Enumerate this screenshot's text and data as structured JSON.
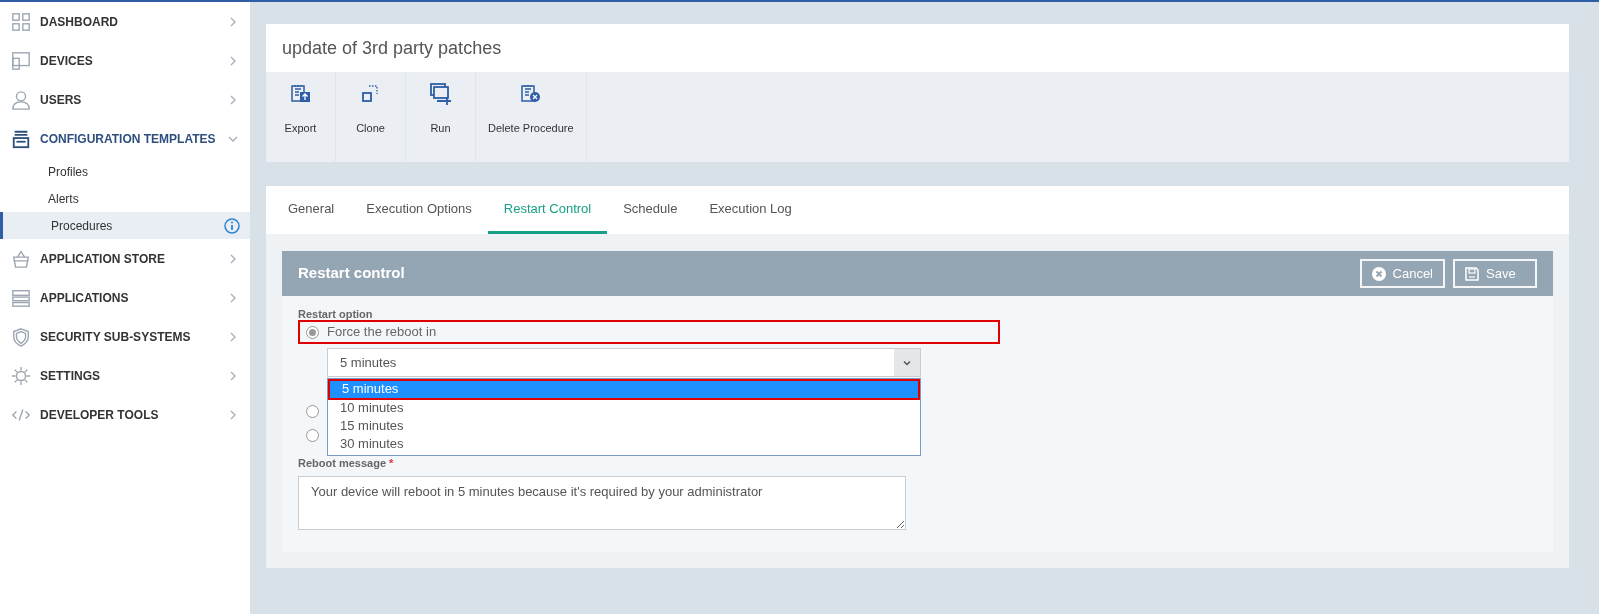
{
  "sidebar": {
    "items": [
      {
        "label": "DASHBOARD",
        "expanded": false
      },
      {
        "label": "DEVICES",
        "expanded": false
      },
      {
        "label": "USERS",
        "expanded": false
      },
      {
        "label": "CONFIGURATION TEMPLATES",
        "expanded": true,
        "children": [
          {
            "label": "Profiles",
            "selected": false
          },
          {
            "label": "Alerts",
            "selected": false
          },
          {
            "label": "Procedures",
            "selected": true
          }
        ]
      },
      {
        "label": "APPLICATION STORE",
        "expanded": false
      },
      {
        "label": "APPLICATIONS",
        "expanded": false
      },
      {
        "label": "SECURITY SUB-SYSTEMS",
        "expanded": false
      },
      {
        "label": "SETTINGS",
        "expanded": false
      },
      {
        "label": "DEVELOPER TOOLS",
        "expanded": false
      }
    ]
  },
  "page_title": "update of 3rd party patches",
  "toolbar": [
    "Export",
    "Clone",
    "Run",
    "Delete Procedure"
  ],
  "tabs": [
    {
      "label": "General",
      "selected": false
    },
    {
      "label": "Execution Options",
      "selected": false
    },
    {
      "label": "Restart Control",
      "selected": true
    },
    {
      "label": "Schedule",
      "selected": false
    },
    {
      "label": "Execution Log",
      "selected": false
    }
  ],
  "panel": {
    "title": "Restart control",
    "buttons": [
      "Cancel",
      "Save"
    ],
    "restart_option_label": "Restart option",
    "restart_options": [
      {
        "label": "Force the reboot in",
        "selected": true,
        "highlighted": true
      },
      {
        "selected": false,
        "highlighted": false
      },
      {
        "selected": false,
        "highlighted": false
      }
    ],
    "delay_select": {
      "value": "5 minutes",
      "options": [
        {
          "label": "5 minutes",
          "selected": true,
          "highlighted": true
        },
        {
          "label": "10 minutes",
          "selected": false,
          "highlighted": false
        },
        {
          "label": "15 minutes",
          "selected": false,
          "highlighted": false
        },
        {
          "label": "30 minutes",
          "selected": false,
          "highlighted": false
        }
      ]
    },
    "reboot_message_label": "Reboot message",
    "required_mark": "*",
    "reboot_message": "Your device will reboot in 5 minutes because it's required by your administrator"
  }
}
